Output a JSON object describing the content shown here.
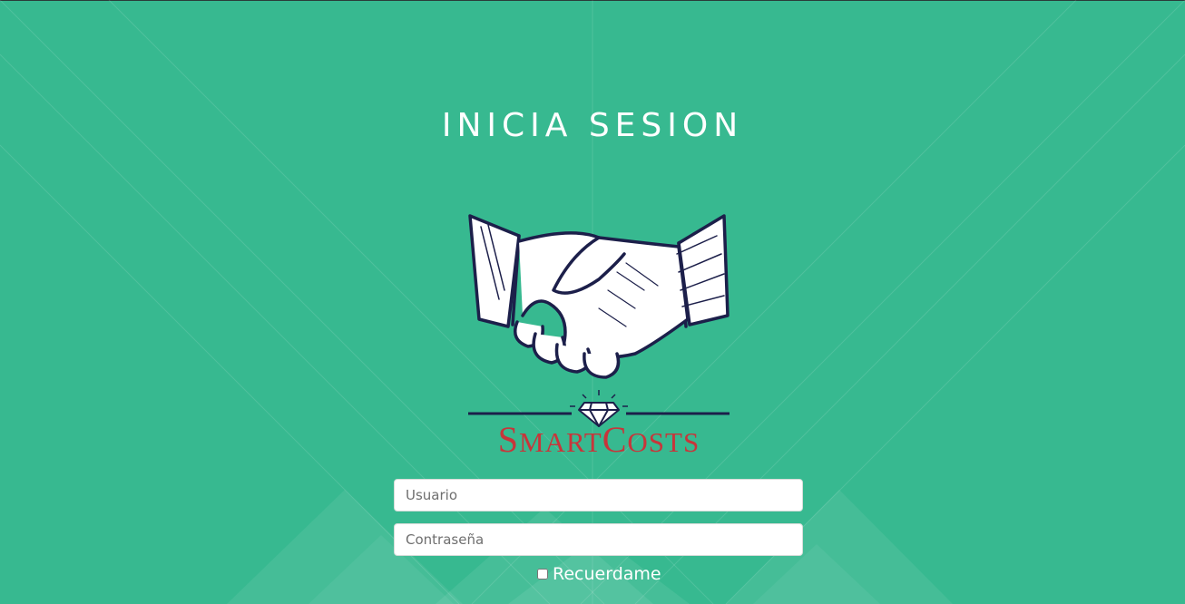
{
  "page": {
    "title": "INICIA SESION",
    "background_color": "#37b990"
  },
  "logo": {
    "brand_text_cap1": "S",
    "brand_text_small1": "MART",
    "brand_text_cap2": "C",
    "brand_text_small2": "OSTS",
    "brand_color": "#c8353a",
    "icon": "handshake-icon"
  },
  "form": {
    "username_placeholder": "Usuario",
    "password_placeholder": "Contraseña",
    "remember_label": "Recuerdame",
    "remember_checked": false
  }
}
